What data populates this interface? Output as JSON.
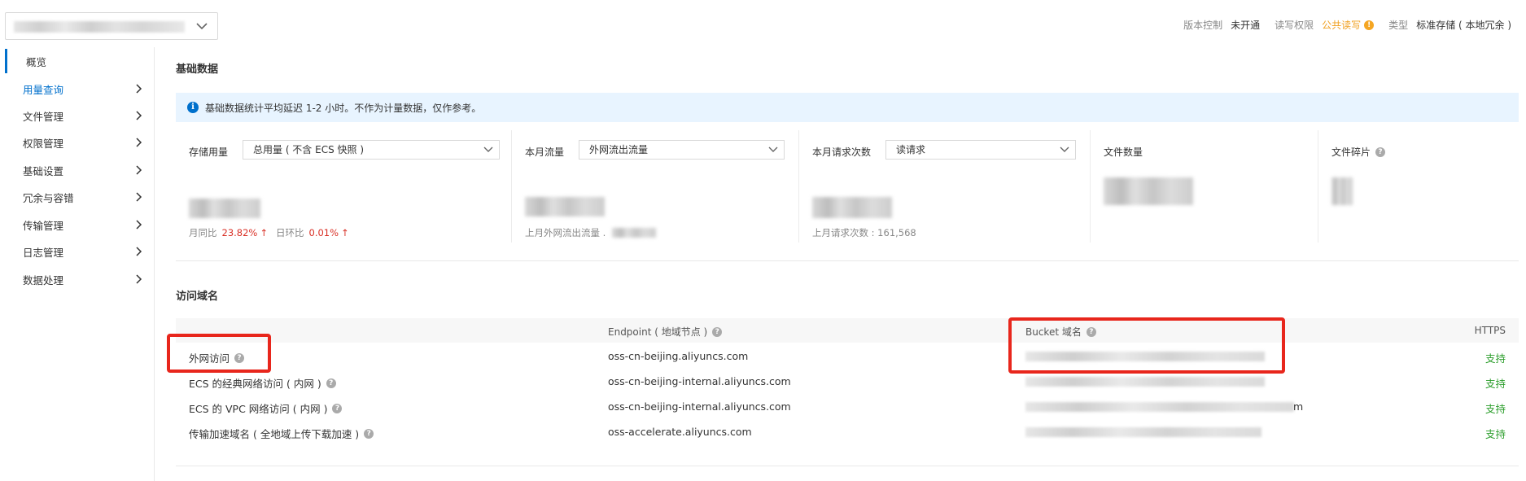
{
  "topbar": {
    "meta": [
      {
        "key": "版本控制",
        "value": "未开通"
      },
      {
        "key": "读写权限",
        "value": "公共读写",
        "warn": "!"
      },
      {
        "key": "类型",
        "value": "标准存储 ( 本地冗余 )"
      }
    ]
  },
  "sidebar": {
    "items": [
      {
        "label": "概览"
      },
      {
        "label": "用量查询"
      },
      {
        "label": "文件管理"
      },
      {
        "label": "权限管理"
      },
      {
        "label": "基础设置"
      },
      {
        "label": "冗余与容错"
      },
      {
        "label": "传输管理"
      },
      {
        "label": "日志管理"
      },
      {
        "label": "数据处理"
      }
    ]
  },
  "basic": {
    "title": "基础数据",
    "notice": "基础数据统计平均延迟 1-2 小时。不作为计量数据，仅作参考。",
    "storage": {
      "label": "存储用量",
      "select": "总用量 ( 不含 ECS 快照 )",
      "mom_label": "月同比",
      "mom_value": "23.82%",
      "dod_label": "日环比",
      "dod_value": "0.01%",
      "arrow": "↑"
    },
    "traffic": {
      "label": "本月流量",
      "select": "外网流出流量",
      "sub": "上月外网流出流量 ."
    },
    "requests": {
      "label": "本月请求次数",
      "select": "读请求",
      "sub": "上月请求次数 :  161,568"
    },
    "files": {
      "label": "文件数量"
    },
    "fragments": {
      "label": "文件碎片",
      "help": "?"
    }
  },
  "domains": {
    "title": "访问域名",
    "headers": {
      "endpoint": "Endpoint ( 地域节点 )",
      "bucket": "Bucket 域名",
      "https": "HTTPS"
    },
    "help": "?",
    "rows": [
      {
        "name": "外网访问",
        "endpoint": "oss-cn-beijing.aliyuncs.com",
        "https": "支持"
      },
      {
        "name": "ECS 的经典网络访问 ( 内网 )",
        "endpoint": "oss-cn-beijing-internal.aliyuncs.com",
        "https": "支持"
      },
      {
        "name": "ECS 的 VPC 网络访问 ( 内网 )",
        "endpoint": "oss-cn-beijing-internal.aliyuncs.com",
        "https": "支持"
      },
      {
        "name": "传输加速域名 ( 全地域上传下载加速 )",
        "endpoint": "oss-accelerate.aliyuncs.com",
        "https": "支持"
      }
    ],
    "bucket_suffix": "m"
  },
  "colors": {
    "accent": "#0070cc",
    "success": "#2a9d2a",
    "danger": "#d93026",
    "warning": "#f5a623",
    "annotation": "#e8261c"
  }
}
